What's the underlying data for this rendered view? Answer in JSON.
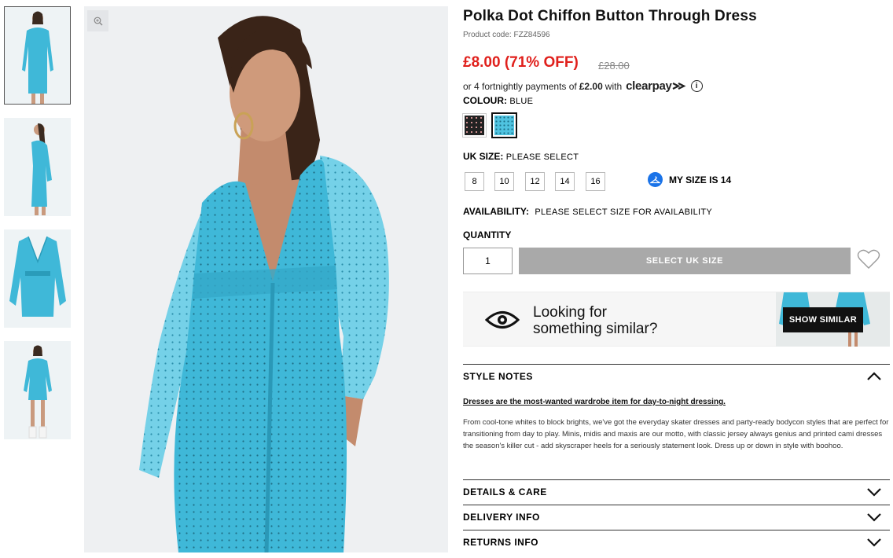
{
  "product": {
    "title": "Polka Dot Chiffon Button Through Dress",
    "code": "Product code: FZZ84596",
    "price": "£8.00 (71% OFF)",
    "was_price": "£28.00",
    "clearpay_prefix": "or 4 fortnightly payments of",
    "clearpay_amount": "£2.00",
    "clearpay_with": "with",
    "clearpay_brand": "clearpay",
    "info_icon": "i"
  },
  "colour": {
    "label": "COLOUR:",
    "value": "BLUE",
    "swatches": [
      "black-polka",
      "blue-polka"
    ]
  },
  "size": {
    "label": "UK SIZE:",
    "value": "PLEASE SELECT",
    "options": [
      "8",
      "10",
      "12",
      "14",
      "16"
    ],
    "my_size": "MY SIZE IS 14"
  },
  "availability": {
    "label": "AVAILABILITY:",
    "value": "PLEASE SELECT SIZE FOR AVAILABILITY"
  },
  "quantity": {
    "label": "QUANTITY",
    "value": "1"
  },
  "cta": {
    "select_size": "SELECT UK SIZE"
  },
  "similar": {
    "line1": "Looking for",
    "line2": "something similar?",
    "button": "SHOW SIMILAR"
  },
  "accordion": {
    "style_notes": "STYLE NOTES",
    "details": "DETAILS & CARE",
    "delivery": "DELIVERY INFO",
    "returns": "RETURNS INFO"
  },
  "style_notes": {
    "headline": "Dresses are the most-wanted wardrobe item for day-to-night dressing.",
    "body": "From cool-tone whites to block brights, we've got the everyday skater dresses and party-ready bodycon styles that are perfect for transitioning from day to play. Minis, midis and maxis are our motto, with classic jersey always genius and printed cami dresses the season's killer cut - add skyscraper heels for a seriously statement look. Dress up or down in style with boohoo."
  },
  "icons": {
    "zoom": "zoom-in-icon",
    "heart": "heart-icon",
    "eye": "eye-icon",
    "hanger": "hanger-icon",
    "chevron_up": "chevron-up-icon",
    "chevron_down": "chevron-down-icon"
  },
  "colors": {
    "sale_red": "#e0201c",
    "dress_blue": "#3fb8d8",
    "button_grey": "#a9a9a9",
    "my_size_blue": "#1a73e8"
  }
}
